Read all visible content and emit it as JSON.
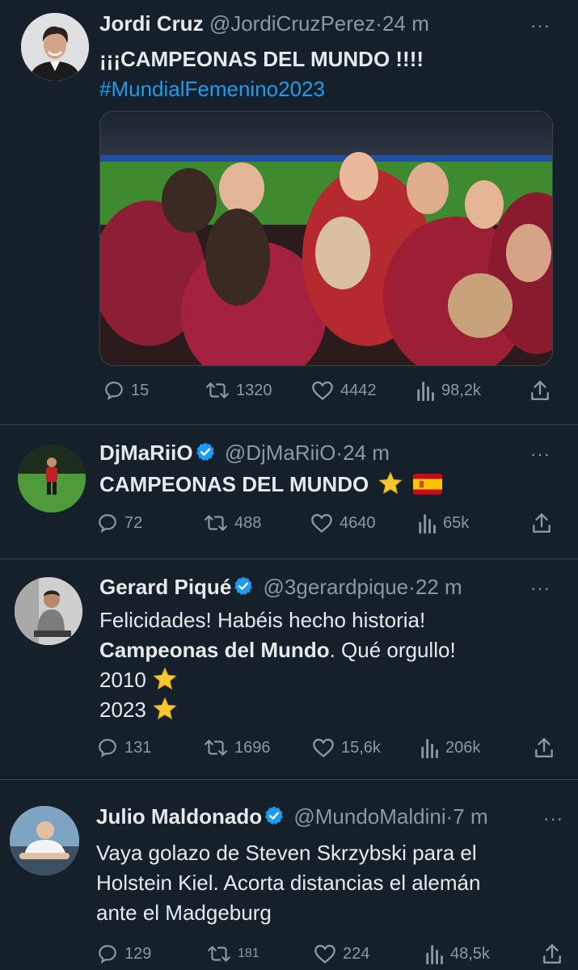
{
  "tweets": [
    {
      "name": "Jordi Cruz",
      "handle": "@JordiCruzPerez",
      "time": "24 m",
      "text_line1": "¡¡¡CAMPEONAS DEL MUNDO !!!!",
      "hashtag": "#MundialFemenino2023",
      "replies": "15",
      "retweets": "1320",
      "likes": "4442",
      "views": "98,2k"
    },
    {
      "name": "DjMaRiiO",
      "handle": "@DjMaRiiO",
      "time": "24 m",
      "text": "CAMPEONAS DEL MUNDO",
      "replies": "72",
      "retweets": "488",
      "likes": "4640",
      "views": "65k"
    },
    {
      "name": "Gerard Piqué",
      "handle": "@3gerardpique",
      "time": "22 m",
      "line1": "Felicidades! Habéis hecho historia!",
      "line2_bold": "Campeonas del Mundo",
      "line2_rest": ". Qué orgullo!",
      "line3": "2010",
      "line4": "2023",
      "replies": "131",
      "retweets": "1696",
      "likes": "15,6k",
      "views": "206k"
    },
    {
      "name": "Julio Maldonado",
      "handle": "@MundoMaldini",
      "time": "7 m",
      "line1": "Vaya golazo de Steven Skrzybski para el",
      "line2": "Holstein Kiel. Acorta distancias el alemán",
      "line3": "ante el Madgeburg",
      "replies": "129",
      "retweets": "181",
      "likes": "224",
      "views": "48,5k"
    }
  ],
  "separator": "·",
  "more_label": "···",
  "icons": [
    "reply-icon",
    "retweet-icon",
    "like-icon",
    "views-icon",
    "share-icon",
    "verified-icon",
    "star-icon",
    "spain-flag-icon"
  ],
  "colors": {
    "background": "#15202b",
    "text": "#e7e9ea",
    "muted": "#8b98a5",
    "link": "#1d9bf0",
    "divider": "#38444d"
  }
}
